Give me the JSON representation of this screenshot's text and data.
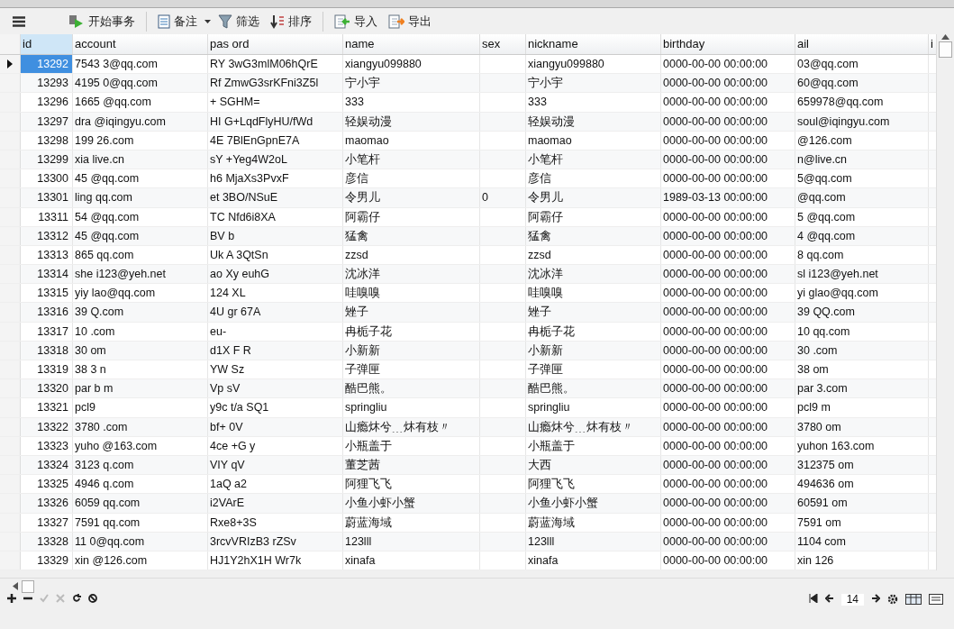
{
  "toolbar": {
    "items": [
      {
        "kind": "txn",
        "label": "开始事务"
      },
      {
        "kind": "memo",
        "label": "备注"
      },
      {
        "kind": "filter",
        "label": "筛选"
      },
      {
        "kind": "sort",
        "label": "排序"
      },
      {
        "kind": "import",
        "label": "导入"
      },
      {
        "kind": "export",
        "label": "导出"
      }
    ]
  },
  "table": {
    "columns": [
      "id",
      "account",
      "pas ord",
      "name",
      "sex",
      "nickname",
      "birthday",
      "ail",
      "i"
    ],
    "rows": [
      {
        "selected": true,
        "cells": [
          "13292",
          "7543 3@qq.com",
          "RY 3wG3mlM06hQrE",
          "xiangyu099880",
          null,
          "xiangyu099880",
          "0000-00-00 00:00:00",
          "03@qq.com"
        ]
      },
      {
        "selected": false,
        "cells": [
          "13293",
          "4195 0@qq.com",
          "Rf ZmwG3srKFni3Z5l",
          "宁小宇",
          null,
          "宁小宇",
          "0000-00-00 00:00:00",
          "60@qq.com"
        ]
      },
      {
        "selected": false,
        "cells": [
          "13296",
          "1665 @qq.com",
          "+ SGHM=",
          "333",
          null,
          "333",
          "0000-00-00 00:00:00",
          "659978@qq.com"
        ]
      },
      {
        "selected": false,
        "cells": [
          "13297",
          "dra @iqingyu.com",
          "HI G+LqdFlyHU/fWd",
          "轻娱动漫",
          null,
          "轻娱动漫",
          "0000-00-00 00:00:00",
          "soul@iqingyu.com"
        ]
      },
      {
        "selected": false,
        "cells": [
          "13298",
          "199 26.com",
          "4E 7BlEnGpnE7A",
          "maomao",
          null,
          "maomao",
          "0000-00-00 00:00:00",
          "@126.com"
        ]
      },
      {
        "selected": false,
        "cells": [
          "13299",
          "xia live.cn",
          "sY +Yeg4W2oL",
          "小笔杆",
          null,
          "小笔杆",
          "0000-00-00 00:00:00",
          "n@live.cn"
        ]
      },
      {
        "selected": false,
        "cells": [
          "13300",
          "45 @qq.com",
          "h6 MjaXs3PvxF",
          "彦信",
          null,
          "彦信",
          "0000-00-00 00:00:00",
          "5@qq.com"
        ]
      },
      {
        "selected": false,
        "cells": [
          "13301",
          "ling qq.com",
          "et 3BO/NSuE",
          "令男儿",
          "0",
          "令男儿",
          "1989-03-13 00:00:00",
          "@qq.com"
        ]
      },
      {
        "selected": false,
        "cells": [
          "13311",
          "54 @qq.com",
          "TC Nfd6i8XA",
          "阿霸仔",
          null,
          "阿霸仔",
          "0000-00-00 00:00:00",
          "5 @qq.com"
        ]
      },
      {
        "selected": false,
        "cells": [
          "13312",
          "45 @qq.com",
          "BV b",
          "猛禽",
          null,
          "猛禽",
          "0000-00-00 00:00:00",
          "4 @qq.com"
        ]
      },
      {
        "selected": false,
        "cells": [
          "13313",
          "865 qq.com",
          "Uk A 3QtSn",
          "zzsd",
          null,
          "zzsd",
          "0000-00-00 00:00:00",
          "8 qq.com"
        ]
      },
      {
        "selected": false,
        "cells": [
          "13314",
          "she i123@yeh.net",
          "ao Xy euhG",
          "沈冰洋",
          null,
          "沈冰洋",
          "0000-00-00 00:00:00",
          "sl i123@yeh.net"
        ]
      },
      {
        "selected": false,
        "cells": [
          "13315",
          "yiy lao@qq.com",
          "124 XL",
          "哇嗅嗅",
          null,
          "哇嗅嗅",
          "0000-00-00 00:00:00",
          "yi glao@qq.com"
        ]
      },
      {
        "selected": false,
        "cells": [
          "13316",
          "39 Q.com",
          "4U gr 67A",
          "矬子",
          null,
          "矬子",
          "0000-00-00 00:00:00",
          "39 QQ.com"
        ]
      },
      {
        "selected": false,
        "cells": [
          "13317",
          "10 .com",
          "eu-",
          "冉栀子花",
          null,
          "冉栀子花",
          "0000-00-00 00:00:00",
          "10 qq.com"
        ]
      },
      {
        "selected": false,
        "cells": [
          "13318",
          "30 om",
          "d1X F R",
          "小新新",
          null,
          "小新新",
          "0000-00-00 00:00:00",
          "30 .com"
        ]
      },
      {
        "selected": false,
        "cells": [
          "13319",
          "38 3 n",
          "YW Sz",
          "子弹匣",
          null,
          "子弹匣",
          "0000-00-00 00:00:00",
          "38 om"
        ]
      },
      {
        "selected": false,
        "cells": [
          "13320",
          "par b m",
          "Vp sV",
          "酷巴熊。",
          null,
          "酷巴熊。",
          "0000-00-00 00:00:00",
          "par 3.com"
        ]
      },
      {
        "selected": false,
        "cells": [
          "13321",
          "pcl9",
          "y9c t/a SQ1",
          "springliu",
          null,
          "springliu",
          "0000-00-00 00:00:00",
          "pcl9 m"
        ]
      },
      {
        "selected": false,
        "cells": [
          "13322",
          "3780 .com",
          "bf+ 0V",
          "山瘾炑兮﹍炑有枝〃",
          null,
          "山瘾炑兮﹍炑有枝〃",
          "0000-00-00 00:00:00",
          "3780 om"
        ]
      },
      {
        "selected": false,
        "cells": [
          "13323",
          "yuho @163.com",
          "4ce +G y",
          "小瓶盖于",
          null,
          "小瓶盖于",
          "0000-00-00 00:00:00",
          "yuhon 163.com"
        ]
      },
      {
        "selected": false,
        "cells": [
          "13324",
          "3123 q.com",
          "VIY qV",
          "董芝茜",
          null,
          "大西",
          "0000-00-00 00:00:00",
          "312375 om"
        ]
      },
      {
        "selected": false,
        "cells": [
          "13325",
          "4946 q.com",
          "1aQ a2",
          "阿狸飞飞",
          null,
          "阿狸飞飞",
          "0000-00-00 00:00:00",
          "494636 om"
        ]
      },
      {
        "selected": false,
        "cells": [
          "13326",
          "6059 qq.com",
          "i2VArE",
          "小鱼小虾小蟹",
          null,
          "小鱼小虾小蟹",
          "0000-00-00 00:00:00",
          "60591 om"
        ]
      },
      {
        "selected": false,
        "cells": [
          "13327",
          "7591 qq.com",
          "Rxe8+3S",
          "蔚蓝海域",
          null,
          "蔚蓝海域",
          "0000-00-00 00:00:00",
          "7591 om"
        ]
      },
      {
        "selected": false,
        "cells": [
          "13328",
          "11 0@qq.com",
          "3rcvVRIzB3 rZSv",
          "123lll",
          null,
          "123lll",
          "0000-00-00 00:00:00",
          "1104 com"
        ]
      },
      {
        "selected": false,
        "cells": [
          "13329",
          "xin @126.com",
          "HJ1Y2hX1H Wr7k",
          "xinafa",
          null,
          "xinafa",
          "0000-00-00 00:00:00",
          "xin 126"
        ]
      }
    ]
  },
  "pager": {
    "page": "14"
  }
}
